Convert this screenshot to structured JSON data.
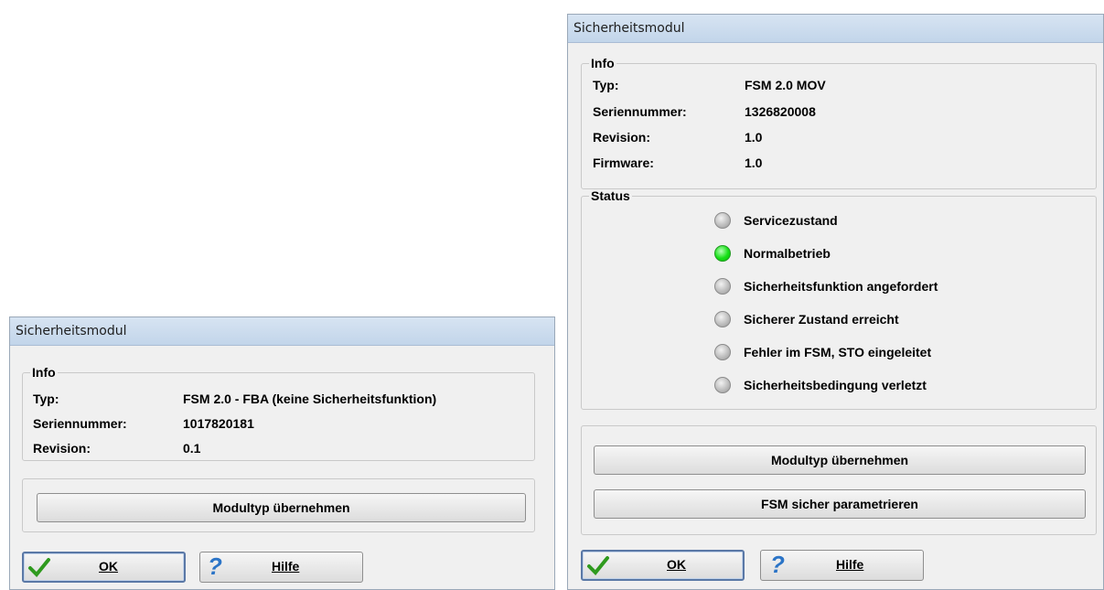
{
  "left_window": {
    "title": "Sicherheitsmodul",
    "info_label": "Info",
    "rows": [
      {
        "label": "Typ:",
        "value": "FSM 2.0 - FBA (keine Sicherheitsfunktion)"
      },
      {
        "label": "Seriennummer:",
        "value": "1017820181"
      },
      {
        "label": "Revision:",
        "value": "0.1"
      }
    ],
    "take_button": "Modultyp übernehmen",
    "ok_button": "OK",
    "help_button": "Hilfe"
  },
  "right_window": {
    "title": "Sicherheitsmodul",
    "info_label": "Info",
    "rows": [
      {
        "label": "Typ:",
        "value": "FSM 2.0 MOV"
      },
      {
        "label": "Seriennummer:",
        "value": "1326820008"
      },
      {
        "label": "Revision:",
        "value": "1.0"
      },
      {
        "label": "Firmware:",
        "value": "1.0"
      }
    ],
    "status_label": "Status",
    "status_items": [
      {
        "label": "Servicezustand",
        "active": false
      },
      {
        "label": "Normalbetrieb",
        "active": true
      },
      {
        "label": "Sicherheitsfunktion angefordert",
        "active": false
      },
      {
        "label": "Sicherer Zustand erreicht",
        "active": false
      },
      {
        "label": "Fehler im FSM, STO eingeleitet",
        "active": false
      },
      {
        "label": "Sicherheitsbedingung verletzt",
        "active": false
      }
    ],
    "take_button": "Modultyp übernehmen",
    "param_button": "FSM sicher parametrieren",
    "ok_button": "OK",
    "help_button": "Hilfe"
  },
  "colors": {
    "active_led": "#16e016",
    "inactive_led": "#b5b5b5",
    "titlebar": "#c2d5ea"
  },
  "icons": {
    "ok": "checkmark-icon",
    "help": "question-mark-icon",
    "led": "status-led-icon"
  }
}
